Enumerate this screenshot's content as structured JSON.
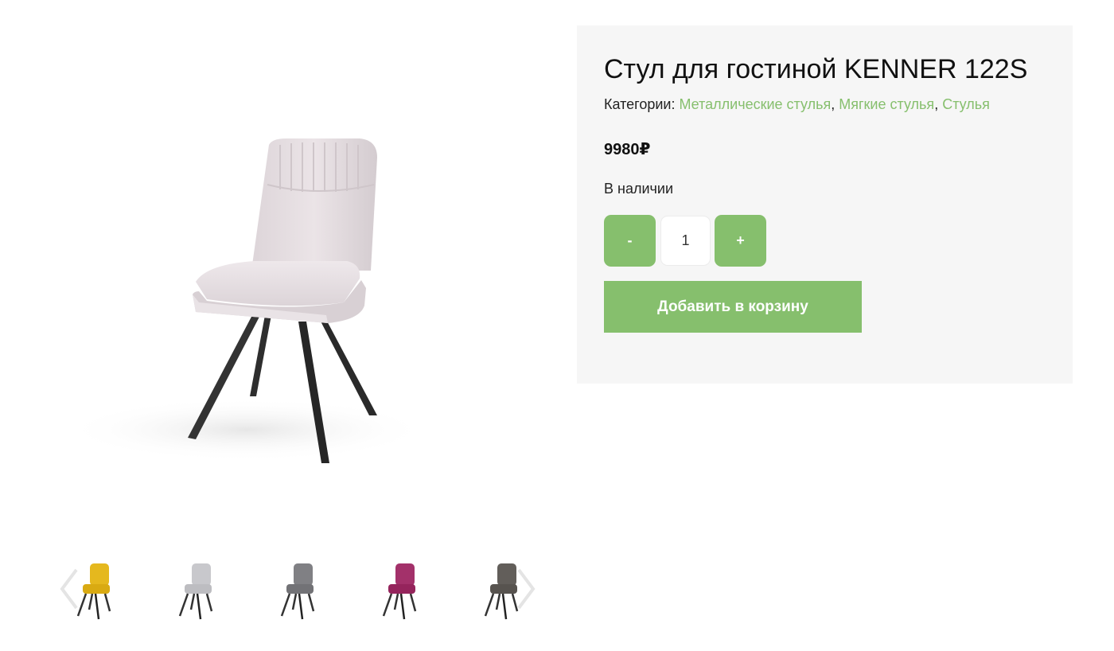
{
  "product": {
    "title": "Стул для гостиной KENNER 122S",
    "categories_label": "Категории:",
    "categories": [
      "Металлические стулья",
      "Мягкие стулья",
      "Стулья"
    ],
    "separator": ",",
    "price": "9980₽",
    "availability": "В наличии",
    "quantity_value": "1",
    "minus_label": "-",
    "plus_label": "+",
    "add_to_cart_label": "Добавить в корзину"
  },
  "gallery": {
    "main_image_icon": "chair-light-grey-icon",
    "prev_icon": "chevron-left-icon",
    "next_icon": "chevron-right-icon",
    "thumbnails": [
      {
        "icon": "chair-yellow-icon",
        "color": "#e5b81e"
      },
      {
        "icon": "chair-light-grey-icon",
        "color": "#c3c3c7"
      },
      {
        "icon": "chair-grey-icon",
        "color": "#7b7b7f"
      },
      {
        "icon": "chair-magenta-icon",
        "color": "#9e2a63"
      },
      {
        "icon": "chair-dark-grey-icon",
        "color": "#5f5b57"
      }
    ]
  },
  "colors": {
    "accent": "#86bf6d",
    "panel_background": "#f6f6f6",
    "main_chair": "#e6dfe2",
    "legs": "#2e2e2e"
  }
}
